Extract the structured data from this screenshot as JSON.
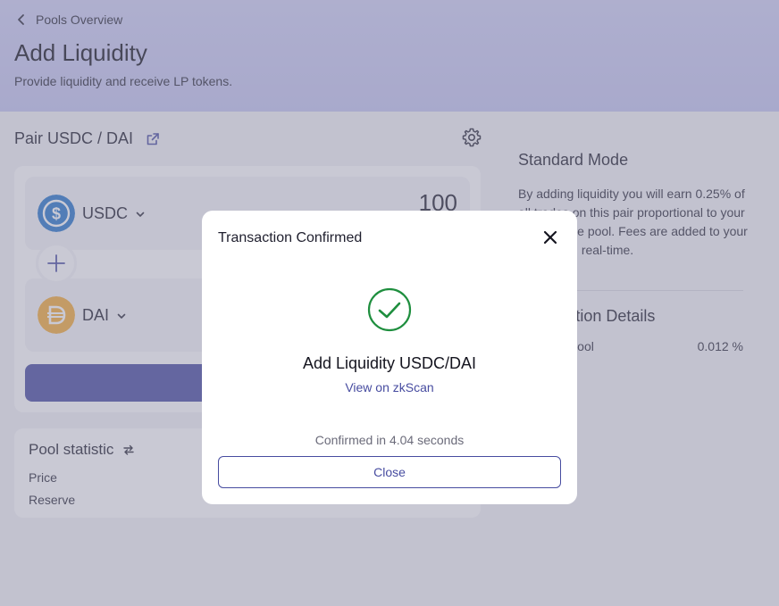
{
  "header": {
    "back_label": "Pools Overview",
    "title": "Add Liquidity",
    "subtitle": "Provide liquidity and receive LP tokens."
  },
  "pair": {
    "title": "Pair USDC / DAI"
  },
  "tokens": [
    {
      "symbol": "USDC",
      "amount": "100",
      "icon": "usdc-icon",
      "color": "#2775ca"
    },
    {
      "symbol": "DAI",
      "amount": "",
      "icon": "dai-icon",
      "color": "#f5ac37"
    }
  ],
  "stats": {
    "title": "Pool statistic",
    "rows": [
      "Price",
      "Reserve"
    ]
  },
  "mode": {
    "title": "Standard Mode",
    "description": "By adding liquidity you will earn 0.25% of all trades on this pair proportional to your share of the pool. Fees are added to your principal in real-time."
  },
  "details": {
    "title": "Transaction Details",
    "share_label": "Share of Pool",
    "share_value": "0.012 %"
  },
  "modal": {
    "title": "Transaction Confirmed",
    "heading": "Add Liquidity USDC/DAI",
    "link": "View on zkScan",
    "note": "Confirmed in 4.04 seconds",
    "close_label": "Close"
  },
  "colors": {
    "accent": "#474ca0",
    "success": "#1e8e3e"
  }
}
